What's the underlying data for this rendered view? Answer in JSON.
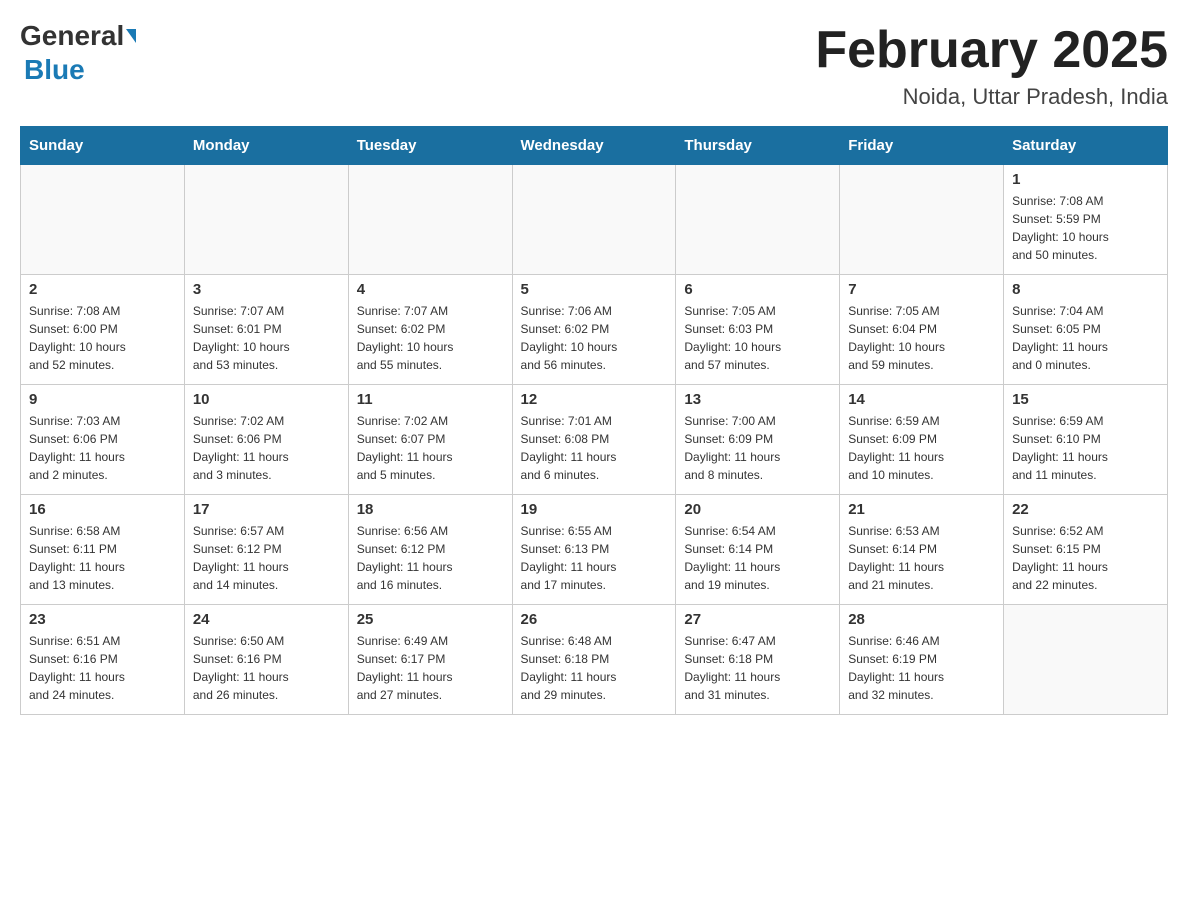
{
  "header": {
    "logo_general": "General",
    "logo_blue": "Blue",
    "title": "February 2025",
    "subtitle": "Noida, Uttar Pradesh, India"
  },
  "days_of_week": [
    "Sunday",
    "Monday",
    "Tuesday",
    "Wednesday",
    "Thursday",
    "Friday",
    "Saturday"
  ],
  "weeks": [
    [
      {
        "day": "",
        "info": ""
      },
      {
        "day": "",
        "info": ""
      },
      {
        "day": "",
        "info": ""
      },
      {
        "day": "",
        "info": ""
      },
      {
        "day": "",
        "info": ""
      },
      {
        "day": "",
        "info": ""
      },
      {
        "day": "1",
        "info": "Sunrise: 7:08 AM\nSunset: 5:59 PM\nDaylight: 10 hours\nand 50 minutes."
      }
    ],
    [
      {
        "day": "2",
        "info": "Sunrise: 7:08 AM\nSunset: 6:00 PM\nDaylight: 10 hours\nand 52 minutes."
      },
      {
        "day": "3",
        "info": "Sunrise: 7:07 AM\nSunset: 6:01 PM\nDaylight: 10 hours\nand 53 minutes."
      },
      {
        "day": "4",
        "info": "Sunrise: 7:07 AM\nSunset: 6:02 PM\nDaylight: 10 hours\nand 55 minutes."
      },
      {
        "day": "5",
        "info": "Sunrise: 7:06 AM\nSunset: 6:02 PM\nDaylight: 10 hours\nand 56 minutes."
      },
      {
        "day": "6",
        "info": "Sunrise: 7:05 AM\nSunset: 6:03 PM\nDaylight: 10 hours\nand 57 minutes."
      },
      {
        "day": "7",
        "info": "Sunrise: 7:05 AM\nSunset: 6:04 PM\nDaylight: 10 hours\nand 59 minutes."
      },
      {
        "day": "8",
        "info": "Sunrise: 7:04 AM\nSunset: 6:05 PM\nDaylight: 11 hours\nand 0 minutes."
      }
    ],
    [
      {
        "day": "9",
        "info": "Sunrise: 7:03 AM\nSunset: 6:06 PM\nDaylight: 11 hours\nand 2 minutes."
      },
      {
        "day": "10",
        "info": "Sunrise: 7:02 AM\nSunset: 6:06 PM\nDaylight: 11 hours\nand 3 minutes."
      },
      {
        "day": "11",
        "info": "Sunrise: 7:02 AM\nSunset: 6:07 PM\nDaylight: 11 hours\nand 5 minutes."
      },
      {
        "day": "12",
        "info": "Sunrise: 7:01 AM\nSunset: 6:08 PM\nDaylight: 11 hours\nand 6 minutes."
      },
      {
        "day": "13",
        "info": "Sunrise: 7:00 AM\nSunset: 6:09 PM\nDaylight: 11 hours\nand 8 minutes."
      },
      {
        "day": "14",
        "info": "Sunrise: 6:59 AM\nSunset: 6:09 PM\nDaylight: 11 hours\nand 10 minutes."
      },
      {
        "day": "15",
        "info": "Sunrise: 6:59 AM\nSunset: 6:10 PM\nDaylight: 11 hours\nand 11 minutes."
      }
    ],
    [
      {
        "day": "16",
        "info": "Sunrise: 6:58 AM\nSunset: 6:11 PM\nDaylight: 11 hours\nand 13 minutes."
      },
      {
        "day": "17",
        "info": "Sunrise: 6:57 AM\nSunset: 6:12 PM\nDaylight: 11 hours\nand 14 minutes."
      },
      {
        "day": "18",
        "info": "Sunrise: 6:56 AM\nSunset: 6:12 PM\nDaylight: 11 hours\nand 16 minutes."
      },
      {
        "day": "19",
        "info": "Sunrise: 6:55 AM\nSunset: 6:13 PM\nDaylight: 11 hours\nand 17 minutes."
      },
      {
        "day": "20",
        "info": "Sunrise: 6:54 AM\nSunset: 6:14 PM\nDaylight: 11 hours\nand 19 minutes."
      },
      {
        "day": "21",
        "info": "Sunrise: 6:53 AM\nSunset: 6:14 PM\nDaylight: 11 hours\nand 21 minutes."
      },
      {
        "day": "22",
        "info": "Sunrise: 6:52 AM\nSunset: 6:15 PM\nDaylight: 11 hours\nand 22 minutes."
      }
    ],
    [
      {
        "day": "23",
        "info": "Sunrise: 6:51 AM\nSunset: 6:16 PM\nDaylight: 11 hours\nand 24 minutes."
      },
      {
        "day": "24",
        "info": "Sunrise: 6:50 AM\nSunset: 6:16 PM\nDaylight: 11 hours\nand 26 minutes."
      },
      {
        "day": "25",
        "info": "Sunrise: 6:49 AM\nSunset: 6:17 PM\nDaylight: 11 hours\nand 27 minutes."
      },
      {
        "day": "26",
        "info": "Sunrise: 6:48 AM\nSunset: 6:18 PM\nDaylight: 11 hours\nand 29 minutes."
      },
      {
        "day": "27",
        "info": "Sunrise: 6:47 AM\nSunset: 6:18 PM\nDaylight: 11 hours\nand 31 minutes."
      },
      {
        "day": "28",
        "info": "Sunrise: 6:46 AM\nSunset: 6:19 PM\nDaylight: 11 hours\nand 32 minutes."
      },
      {
        "day": "",
        "info": ""
      }
    ]
  ]
}
